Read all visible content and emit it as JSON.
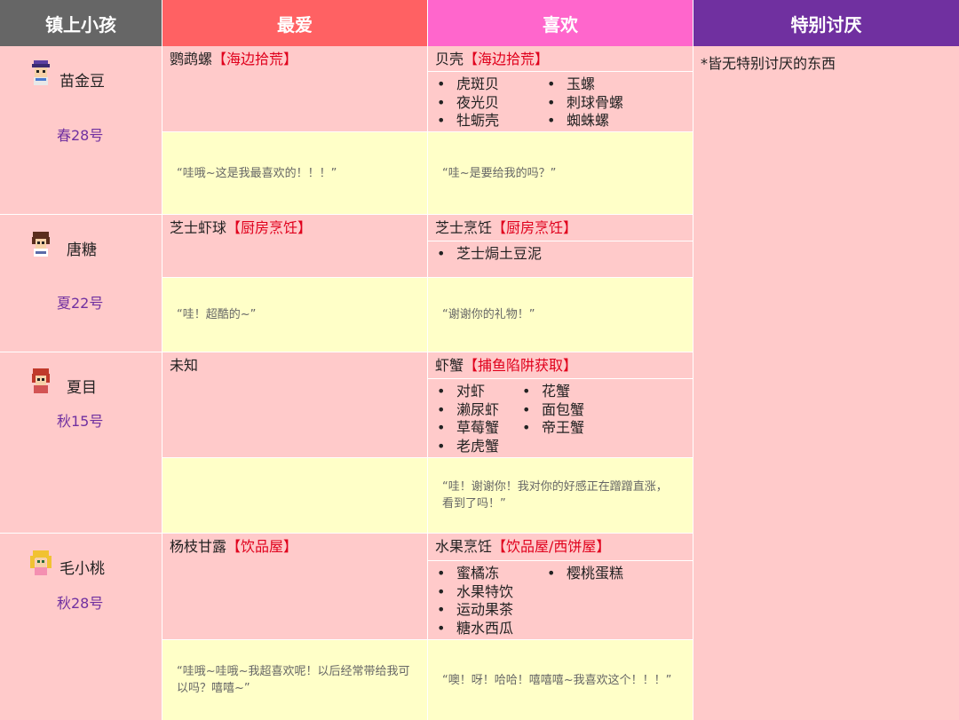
{
  "headers": {
    "c0": "镇上小孩",
    "c1": "最爱",
    "c2": "喜欢",
    "c3": "特别讨厌"
  },
  "hate_text": "*皆无特别讨厌的东西",
  "rows": [
    {
      "name": "苗金豆",
      "birthday": "春28号",
      "fav_item": "鹦鹉螺",
      "fav_tag": "【海边拾荒】",
      "fav_quote": "“哇哦~这是我最喜欢的！！！”",
      "like_item": "贝壳",
      "like_tag": "【海边拾荒】",
      "like_list_left": [
        "虎斑贝",
        "夜光贝",
        "牡蛎壳"
      ],
      "like_list_right": [
        "玉螺",
        "刺球骨螺",
        "蜘蛛螺"
      ],
      "like_quote": "“哇~是要给我的吗？”"
    },
    {
      "name": "唐糖",
      "birthday": "夏22号",
      "fav_item": "芝士虾球",
      "fav_tag": "【厨房烹饪】",
      "fav_quote": "“哇！超酷的~”",
      "like_item": "芝士烹饪",
      "like_tag": "【厨房烹饪】",
      "like_list_left": [
        "芝士焗土豆泥"
      ],
      "like_list_right": [],
      "like_quote": "“谢谢你的礼物！”"
    },
    {
      "name": "夏目",
      "birthday": "秋15号",
      "fav_item": "未知",
      "fav_tag": "",
      "fav_quote": "",
      "like_item": "虾蟹",
      "like_tag": "【捕鱼陷阱获取】",
      "like_list_left": [
        "对虾",
        "濑尿虾",
        "草莓蟹",
        "老虎蟹"
      ],
      "like_list_right": [
        "花蟹",
        "面包蟹",
        "帝王蟹"
      ],
      "like_quote": "“哇！谢谢你！我对你的好感正在蹭蹭直涨，看到了吗！”"
    },
    {
      "name": "毛小桃",
      "birthday": "秋28号",
      "fav_item": "杨枝甘露",
      "fav_tag": "【饮品屋】",
      "fav_quote": "“哇哦~哇哦~我超喜欢呢！以后经常带给我可以吗？嘻嘻~”",
      "like_item": "水果烹饪",
      "like_tag": "【饮品屋/西饼屋】",
      "like_list_left": [
        "蜜橘冻",
        "水果特饮",
        "运动果茶",
        "糖水西瓜"
      ],
      "like_list_right": [
        "樱桃蛋糕"
      ],
      "like_quote": "“噢！呀！哈哈！嘻嘻嘻~我喜欢这个！！！”"
    }
  ],
  "bullet": "•",
  "colors": {
    "header_kids": "#666666",
    "header_fav": "#ff6163",
    "header_like": "#ff66cc",
    "header_hate": "#7030a0",
    "cell_pink": "#ffcaca",
    "cell_yellow": "#ffffc8",
    "source_tag": "#e0001c",
    "birthday": "#7030a0"
  },
  "icons": [
    "kid-avatar-icon"
  ]
}
